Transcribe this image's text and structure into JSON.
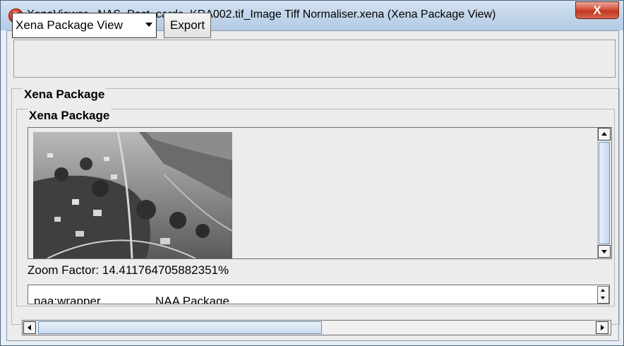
{
  "window": {
    "title": "XenaViewer - NAS_Post_cards_KRA002.tif_Image Tiff Normaliser.xena (Xena Package View)",
    "close_label": "X",
    "app_icon": "xena-app-icon"
  },
  "toolbar": {
    "view_select_value": "Xena Package View",
    "export_label": "Export"
  },
  "outer_group": {
    "title": "Xena Package"
  },
  "inner_group": {
    "title": "Xena Package"
  },
  "image_panel": {
    "image": "aerial-photo-of-town",
    "zoom_text": "Zoom Factor: 14.411764705882351%"
  },
  "properties": [
    {
      "key": "naa:wrapper",
      "value": "NAA Package"
    }
  ],
  "colors": {
    "title_bar": "#c2d5ea",
    "close_button": "#c2361f",
    "client_bg": "#ececec",
    "scroll_thumb": "#c5d8ee"
  }
}
